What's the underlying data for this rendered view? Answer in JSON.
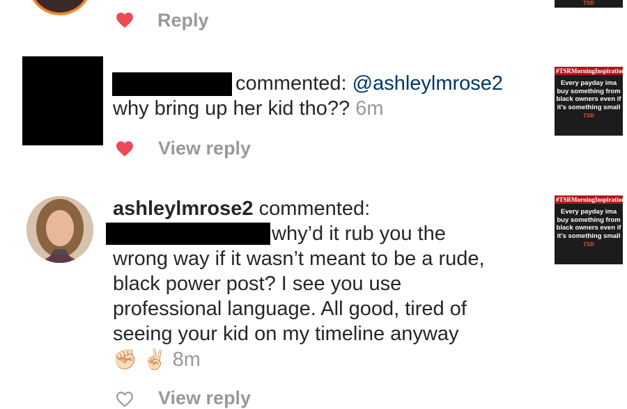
{
  "comment1": {
    "reply_label": "Reply",
    "liked": true
  },
  "comment2": {
    "commented_label": "commented:",
    "mention": "@ashleylmrose2",
    "body": "why bring up her kid tho??",
    "time": "6m",
    "view_reply_label": "View reply",
    "liked": true
  },
  "comment3": {
    "username": "ashleylmrose2",
    "commented_label": "commented:",
    "line1": "why’d it rub you the",
    "line2": "wrong way if it wasn’t meant to be a rude,",
    "line3": "black power post? I see you use",
    "line4": "professional language. All good, tired of",
    "line5": "seeing your kid on my timeline anyway",
    "emojis": "✊🏻 ✌🏻",
    "time": "8m",
    "view_reply_label": "View reply",
    "liked": false
  },
  "post_thumbnail": {
    "tag": "#TSRMorningInspiration",
    "quote": "Every payday ima buy something from black owners even if it's something small",
    "logo": "TSR"
  },
  "colors": {
    "heart_red": "#ed4956",
    "mention_blue": "#003569",
    "secondary_gray": "#999999"
  }
}
